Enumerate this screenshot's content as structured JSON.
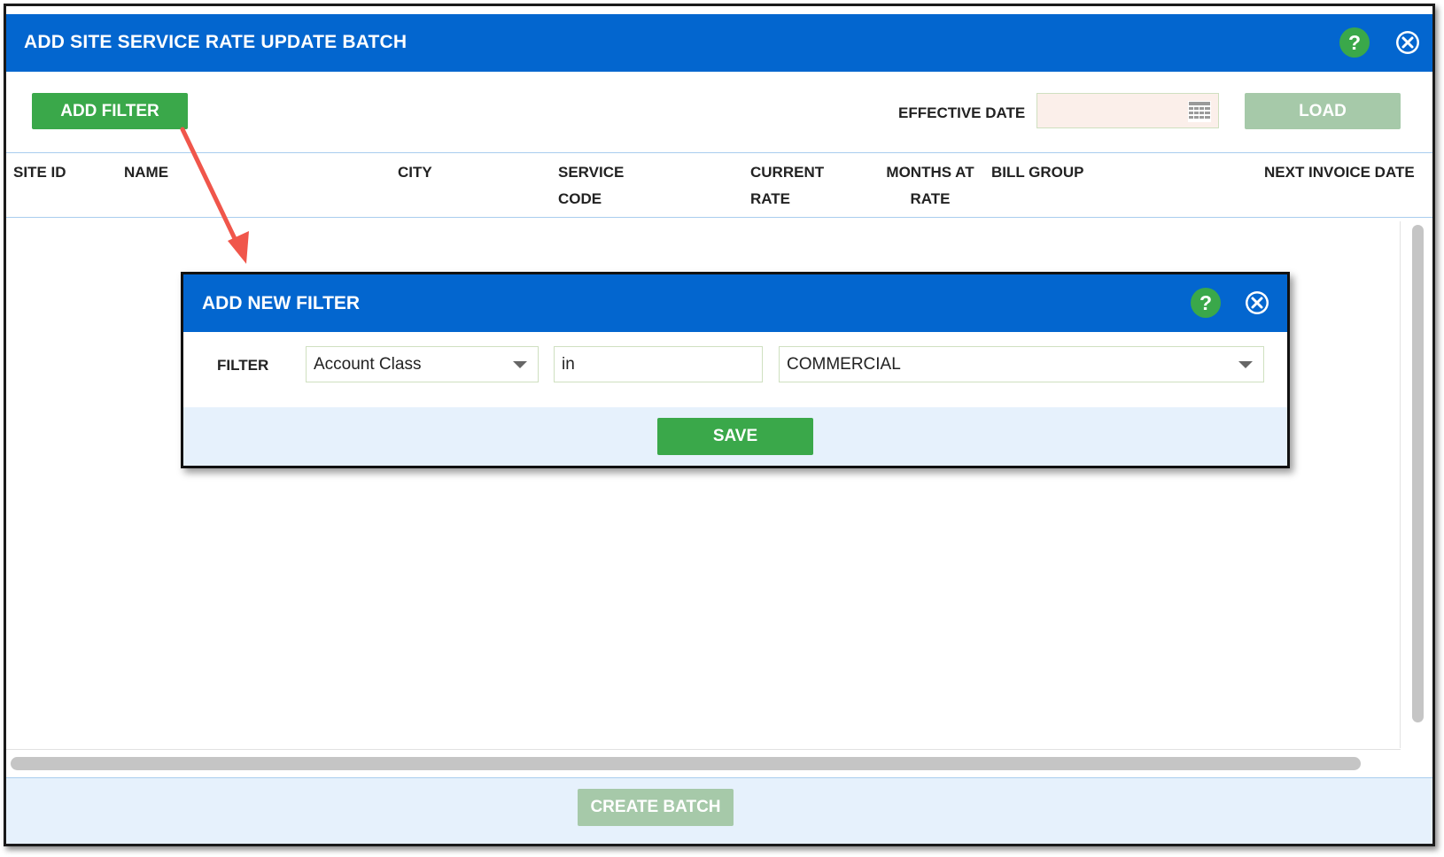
{
  "window": {
    "title": "ADD SITE SERVICE RATE UPDATE BATCH",
    "help_label": "?"
  },
  "toolbar": {
    "add_filter_label": "ADD FILTER",
    "effective_date_label": "EFFECTIVE DATE",
    "effective_date_value": "",
    "load_label": "LOAD"
  },
  "table": {
    "columns": [
      {
        "line1": "SITE ID",
        "line2": ""
      },
      {
        "line1": "NAME",
        "line2": ""
      },
      {
        "line1": "CITY",
        "line2": ""
      },
      {
        "line1": "SERVICE",
        "line2": "CODE"
      },
      {
        "line1": "CURRENT",
        "line2": "RATE"
      },
      {
        "line1": "MONTHS AT",
        "line2": "RATE"
      },
      {
        "line1": "BILL GROUP",
        "line2": ""
      },
      {
        "line1": "NEXT INVOICE DATE",
        "line2": ""
      }
    ],
    "rows": []
  },
  "footer": {
    "create_batch_label": "CREATE BATCH"
  },
  "modal": {
    "title": "ADD NEW FILTER",
    "help_label": "?",
    "filter_label": "FILTER",
    "field_value": "Account Class",
    "operator_value": "in",
    "value_value": "COMMERCIAL",
    "save_label": "SAVE"
  },
  "colors": {
    "titlebar": "#0366cf",
    "primary_green": "#3aa84a",
    "disabled_green": "#a6c9a9",
    "footer_bg": "#e6f1fc",
    "annotation_arrow": "#f0564b"
  },
  "icons": {
    "help": "help-icon",
    "close": "close-icon",
    "calendar": "calendar-icon",
    "dropdown": "chevron-down-icon",
    "annotation": "annotation-arrow"
  }
}
